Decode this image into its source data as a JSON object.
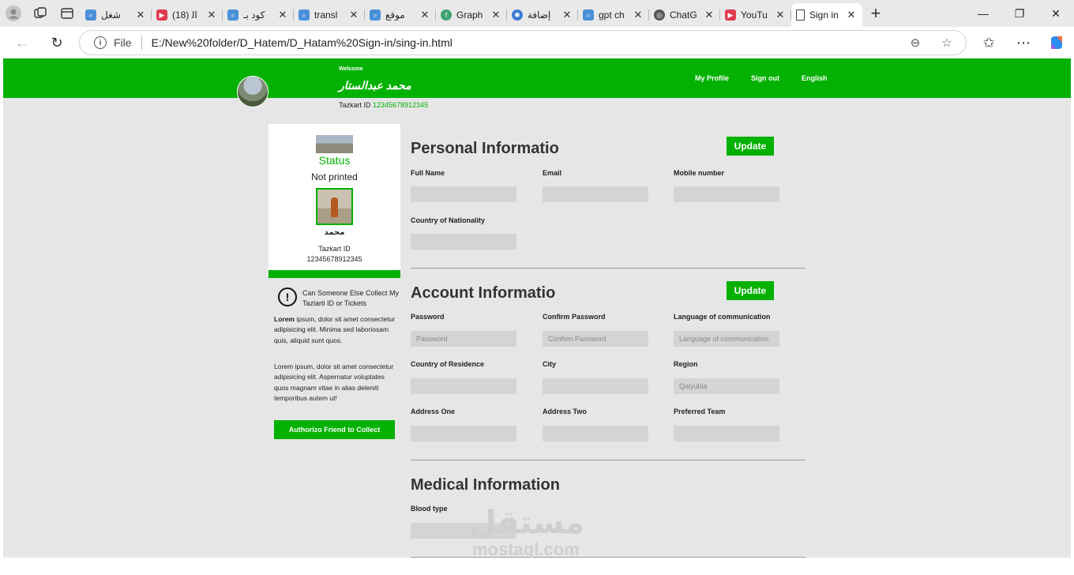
{
  "browser": {
    "tabs": [
      {
        "title": "شغل",
        "fav": "search-icon",
        "color": "#4a90d9"
      },
      {
        "title": "(18) اﻟ",
        "fav": "youtube-icon",
        "color": "#e03a4e"
      },
      {
        "title": "كود بـ",
        "fav": "search-icon",
        "color": "#4a90d9"
      },
      {
        "title": "transl",
        "fav": "search-icon",
        "color": "#4a90d9"
      },
      {
        "title": "موقع",
        "fav": "search-icon",
        "color": "#4a90d9"
      },
      {
        "title": "Graph",
        "fav": "figma-icon",
        "color": "#3fa371"
      },
      {
        "title": "إضافة",
        "fav": "gear-icon",
        "color": "#3c7bd5"
      },
      {
        "title": "gpt ch",
        "fav": "search-icon",
        "color": "#4a90d9"
      },
      {
        "title": "ChatG",
        "fav": "openai-icon",
        "color": "#555555"
      },
      {
        "title": "YouTu",
        "fav": "youtube-icon",
        "color": "#e03a4e"
      },
      {
        "title": "Sign in",
        "fav": "page-icon",
        "color": "#555555"
      }
    ],
    "url_label": "File",
    "url": "E:/New%20folder/D_Hatem/D_Hatam%20Sign-in/sing-in.html"
  },
  "colors": {
    "accent": "#02b102",
    "page_bg": "#e6e6e6"
  },
  "header": {
    "welcome": "Welcome",
    "user_name": "محمد عبدالستار",
    "tazkart_label": "Tazkart ID",
    "tazkart_id": "12345678912345",
    "nav": {
      "profile": "My Profile",
      "signout": "Sign out",
      "language": "English"
    }
  },
  "card": {
    "status_title": "Status",
    "status_value": "Not printed",
    "name": "محمد",
    "tazkart_label": "Tazkart ID",
    "tazkart_id": "12345678912345"
  },
  "sidebar": {
    "alert_icon_text": "!",
    "alert_text": "Can Someone Else Collect My Tazlarti ID or Tickets",
    "para1_bold": "Lorem",
    "para1": " ipsum, dolor sit amet consectetur adipisicing elit. Minima sed laboriosam quis, aliquid sunt quos.",
    "para2": "Lorem ipsum, dolor sit amet consectetur adipisicing elit. Aspernatur voluptates quos magnam vitae in alias deleniti temporibus autem ut!",
    "auth_button": "Authorizo Friend to Collect"
  },
  "personal": {
    "title": "Personal Informatio",
    "update": "Update",
    "full_name": "Full Name",
    "email": "Email",
    "mobile": "Mobile number",
    "country_nat": "Country of Nationality"
  },
  "account": {
    "title": "Account Informatio",
    "update": "Update",
    "password": "Password",
    "password_ph": "Password",
    "confirm": "Confirm Password",
    "confirm_ph": "Confirm Password",
    "lang": "Language of communication",
    "lang_ph": "Language of communication",
    "country_res": "Country of Residence",
    "city": "City",
    "region": "Region",
    "region_ph": "Qalyubia",
    "addr1": "Address One",
    "addr2": "Address Two",
    "team": "Preferred Team"
  },
  "medical": {
    "title": "Medical Information",
    "blood": "Blood type"
  },
  "watermark": {
    "ar": "مستقل",
    "en": "mostaql.com"
  }
}
